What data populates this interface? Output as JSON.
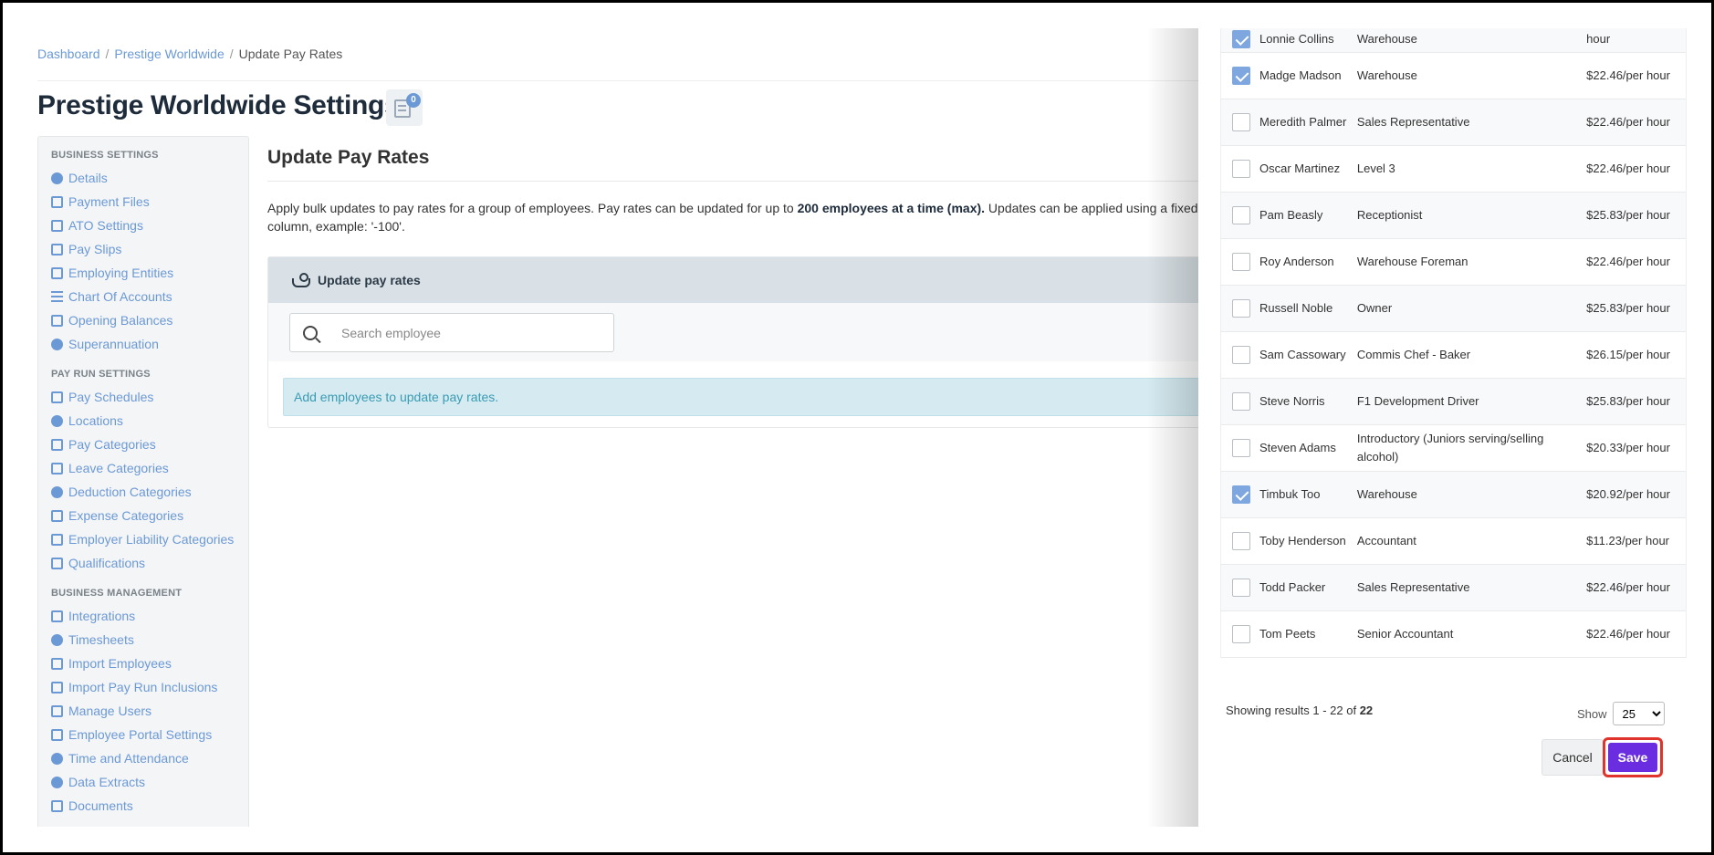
{
  "breadcrumb": {
    "items": [
      "Dashboard",
      "Prestige Worldwide"
    ],
    "current": "Update Pay Rates",
    "separator": "/"
  },
  "page_title": "Prestige Worldwide Settings",
  "notes_badge": "0",
  "sidebar": {
    "sections": [
      {
        "heading": "BUSINESS SETTINGS",
        "items": [
          {
            "label": "Details",
            "icon": "gear-icon"
          },
          {
            "label": "Payment Files",
            "icon": "floppy-icon"
          },
          {
            "label": "ATO Settings",
            "icon": "scales-icon"
          },
          {
            "label": "Pay Slips",
            "icon": "file-icon"
          },
          {
            "label": "Employing Entities",
            "icon": "bank-icon"
          },
          {
            "label": "Chart Of Accounts",
            "icon": "list-icon"
          },
          {
            "label": "Opening Balances",
            "icon": "leaf-icon"
          },
          {
            "label": "Superannuation",
            "icon": "globe-icon"
          }
        ]
      },
      {
        "heading": "PAY RUN SETTINGS",
        "items": [
          {
            "label": "Pay Schedules",
            "icon": "calendar-icon"
          },
          {
            "label": "Locations",
            "icon": "globe-icon"
          },
          {
            "label": "Pay Categories",
            "icon": "money-icon"
          },
          {
            "label": "Leave Categories",
            "icon": "plane-icon"
          },
          {
            "label": "Deduction Categories",
            "icon": "minus-circle-icon"
          },
          {
            "label": "Expense Categories",
            "icon": "archive-icon"
          },
          {
            "label": "Employer Liability Categories",
            "icon": "bar-chart-icon"
          },
          {
            "label": "Qualifications",
            "icon": "check-icon"
          }
        ]
      },
      {
        "heading": "BUSINESS MANAGEMENT",
        "items": [
          {
            "label": "Integrations",
            "icon": "share-icon"
          },
          {
            "label": "Timesheets",
            "icon": "clock-icon"
          },
          {
            "label": "Import Employees",
            "icon": "users-icon"
          },
          {
            "label": "Import Pay Run Inclusions",
            "icon": "refresh-icon"
          },
          {
            "label": "Manage Users",
            "icon": "lock-icon"
          },
          {
            "label": "Employee Portal Settings",
            "icon": "wand-icon"
          },
          {
            "label": "Time and Attendance",
            "icon": "id-badge-icon"
          },
          {
            "label": "Data Extracts",
            "icon": "cloud-download-icon"
          },
          {
            "label": "Documents",
            "icon": "folder-icon"
          }
        ]
      }
    ]
  },
  "main": {
    "title": "Update Pay Rates",
    "intro_part1": "Apply bulk updates to pay rates for a group of employees. Pay rates can be updated for up to ",
    "intro_bold": "200 employees at a time (max).",
    "intro_part2": " Updates can be applied using a fixed $ o",
    "intro_line2": "column, example: '-100'.",
    "panel_title": "Update pay rates",
    "search_placeholder": "Search employee",
    "info_message": "Add employees to update pay rates."
  },
  "drawer": {
    "rows": [
      {
        "name": "Lonnie Collins",
        "position": "Warehouse",
        "rate": "hour",
        "checked": true
      },
      {
        "name": "Madge Madson",
        "position": "Warehouse",
        "rate": "$22.46/per hour",
        "checked": true
      },
      {
        "name": "Meredith Palmer",
        "position": "Sales Representative",
        "rate": "$22.46/per hour",
        "checked": false
      },
      {
        "name": "Oscar Martinez",
        "position": "Level 3",
        "rate": "$22.46/per hour",
        "checked": false
      },
      {
        "name": "Pam Beasly",
        "position": "Receptionist",
        "rate": "$25.83/per hour",
        "checked": false
      },
      {
        "name": "Roy Anderson",
        "position": "Warehouse Foreman",
        "rate": "$22.46/per hour",
        "checked": false
      },
      {
        "name": "Russell Noble",
        "position": "Owner",
        "rate": "$25.83/per hour",
        "checked": false
      },
      {
        "name": "Sam Cassowary",
        "position": "Commis Chef - Baker",
        "rate": "$26.15/per hour",
        "checked": false
      },
      {
        "name": "Steve Norris",
        "position": "F1 Development Driver",
        "rate": "$25.83/per hour",
        "checked": false
      },
      {
        "name": "Steven Adams",
        "position": "Introductory (Juniors serving/selling alcohol)",
        "rate": "$20.33/per hour",
        "checked": false
      },
      {
        "name": "Timbuk Too",
        "position": "Warehouse",
        "rate": "$20.92/per hour",
        "checked": true
      },
      {
        "name": "Toby Henderson",
        "position": "Accountant",
        "rate": "$11.23/per hour",
        "checked": false
      },
      {
        "name": "Todd Packer",
        "position": "Sales Representative",
        "rate": "$22.46/per hour",
        "checked": false
      },
      {
        "name": "Tom Peets",
        "position": "Senior Accountant",
        "rate": "$22.46/per hour",
        "checked": false
      }
    ],
    "results_prefix": "Showing results 1 - 22 of ",
    "results_total": "22",
    "show_label": "Show",
    "show_value": "25",
    "cancel_label": "Cancel",
    "save_label": "Save"
  }
}
